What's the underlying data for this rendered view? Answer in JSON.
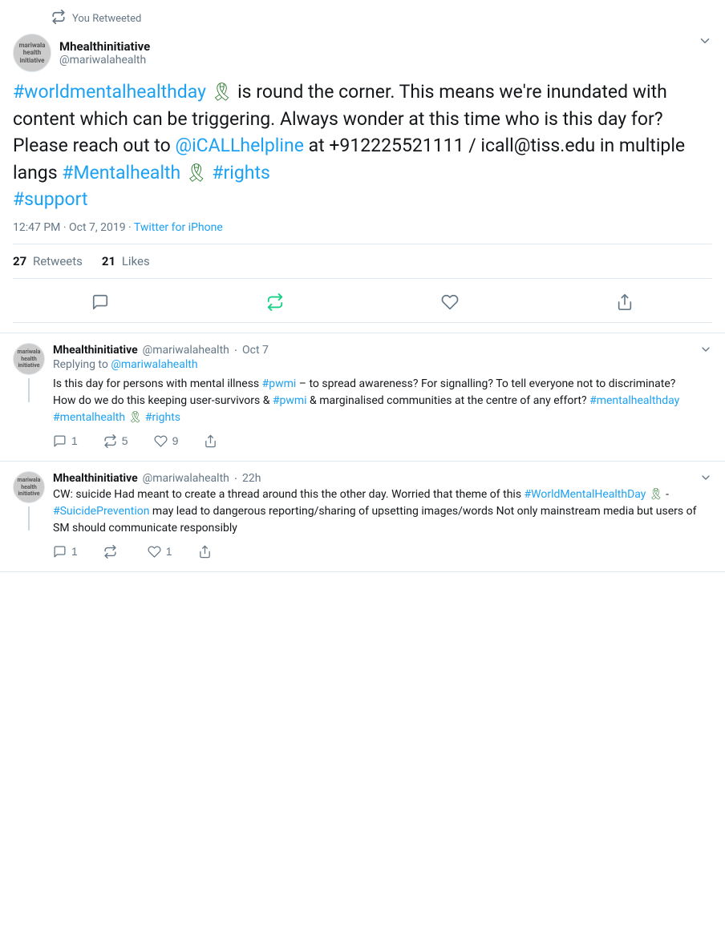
{
  "main_tweet": {
    "retweet_label": "You Retweeted",
    "user": {
      "display_name": "Mhealthinitiative",
      "handle": "@mariwalahealth",
      "avatar_text": "mariwala\nhealth\ninitiative"
    },
    "text_parts": {
      "full_text": "#worldmentalhealthday 🎗 is round the corner. This means we're inundated with content which can be triggering. Always wonder at this time who is this day for? Please reach out to @iCALLhelpline at +912225521111 / icall@tiss.edu in multiple langs #Mentalhealth 🎗  #rights #support"
    },
    "timestamp": "12:47 PM · Oct 7, 2019 · ",
    "source": "Twitter for iPhone",
    "retweets": "27",
    "retweets_label": "Retweets",
    "likes": "21",
    "likes_label": "Likes"
  },
  "replies": [
    {
      "display_name": "Mhealthinitiative",
      "handle": "@mariwalahealth",
      "time": "Oct 7",
      "avatar_text": "mariwala\nhealth\ninitiative",
      "replying_to_label": "Replying to",
      "replying_to_handle": "@mariwalahealth",
      "text": "Is this day for persons with mental illness #pwmi – to spread awareness? For signalling? To tell everyone not to discriminate? How do we do this keeping user-survivors & #pwmi & marginalised communities at the centre of any effort? #mentalhealthday #mentalhealth 🎗 #rights",
      "reply_count": "1",
      "retweet_count": "5",
      "like_count": "9"
    },
    {
      "display_name": "Mhealthinitiative",
      "handle": "@mariwalahealth",
      "time": "22h",
      "avatar_text": "mariwala\nhealth\ninitiative",
      "replying_to_label": "",
      "replying_to_handle": "",
      "text": "CW: suicide Had meant to create a thread around this the other day. Worried that theme of this #WorldMentalHealthDay 🎗 - #SuicidePrevention may lead to dangerous reporting/sharing of upsetting images/words  Not only mainstream media but users of SM should communicate responsibly",
      "reply_count": "1",
      "retweet_count": "",
      "like_count": "1"
    }
  ],
  "icons": {
    "retweet": "↺",
    "reply": "💬",
    "like": "♡",
    "share": "↑",
    "chevron_down": "›"
  }
}
